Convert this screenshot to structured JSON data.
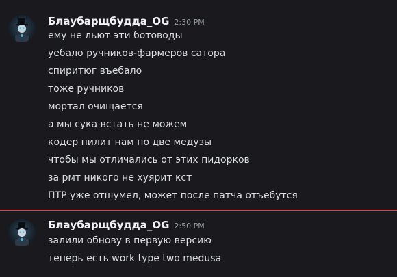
{
  "groups": [
    {
      "username": "Блаубарщбудда_OG",
      "timestamp": "2:30 PM",
      "lines": [
        "ему не льют эти ботоводы",
        "уебало ручников-фармеров сатора",
        "спиритюг въебало",
        "тоже ручников",
        "мортал очищается",
        "а мы сука встать не можем",
        "кодер пилит нам по две медузы",
        "чтобы мы отличались от этих пидорков",
        "за рмт никого не хуярит кст",
        "ПТР уже отшумел, может после патча отъебутся"
      ]
    },
    {
      "username": "Блаубарщбудда_OG",
      "timestamp": "2:50 PM",
      "lines": [
        "залили обнову в первую версию",
        "теперь есть work type two medusa"
      ]
    }
  ],
  "colors": {
    "background": "#1a1a1e",
    "username": "#f2f3f5",
    "timestamp": "#949ba4",
    "text": "#dbdee1",
    "new_messages_divider": "#f23f43"
  }
}
